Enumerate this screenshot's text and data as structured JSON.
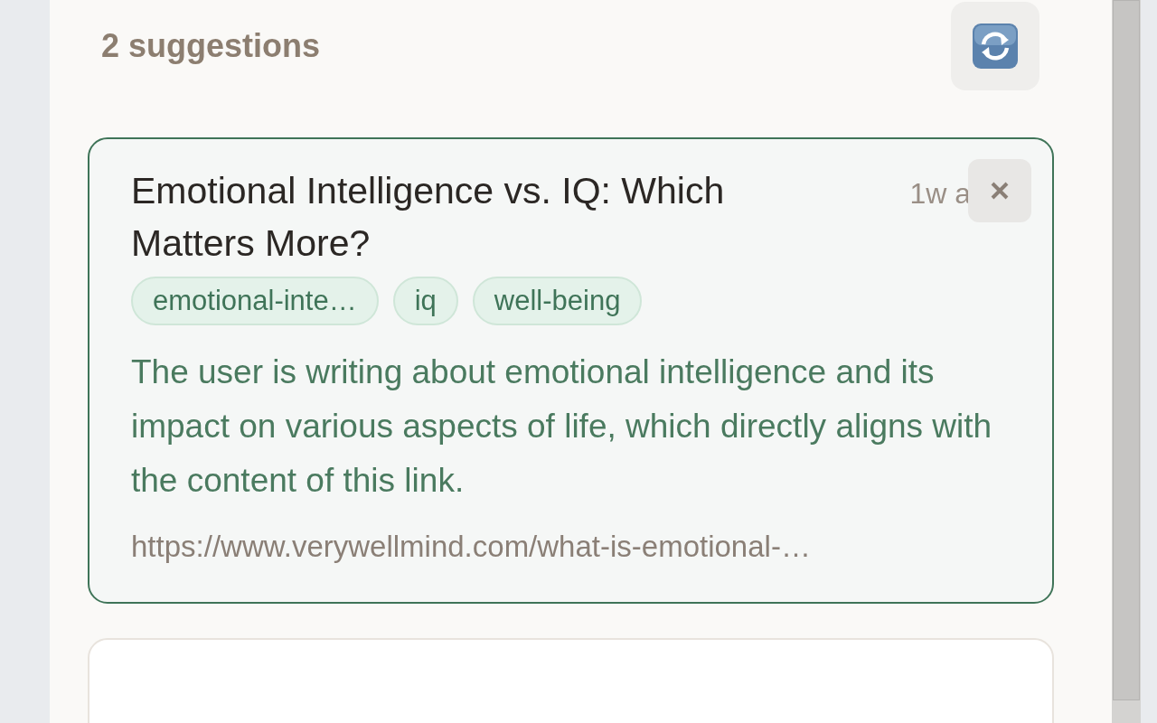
{
  "header": {
    "count_label": "2 suggestions"
  },
  "suggestions": [
    {
      "title": "Emotional Intelligence vs. IQ: Which Matters More?",
      "time": "1w a",
      "selected": true,
      "tags": [
        "emotional-inte…",
        "iq",
        "well-being"
      ],
      "reason": "The user is writing about emotional intelligence and its impact on various aspects of life, which directly aligns with the content of this link.",
      "url": "https://www.verywellmind.com/what-is-emotional-…"
    },
    {
      "selected": false
    }
  ]
}
